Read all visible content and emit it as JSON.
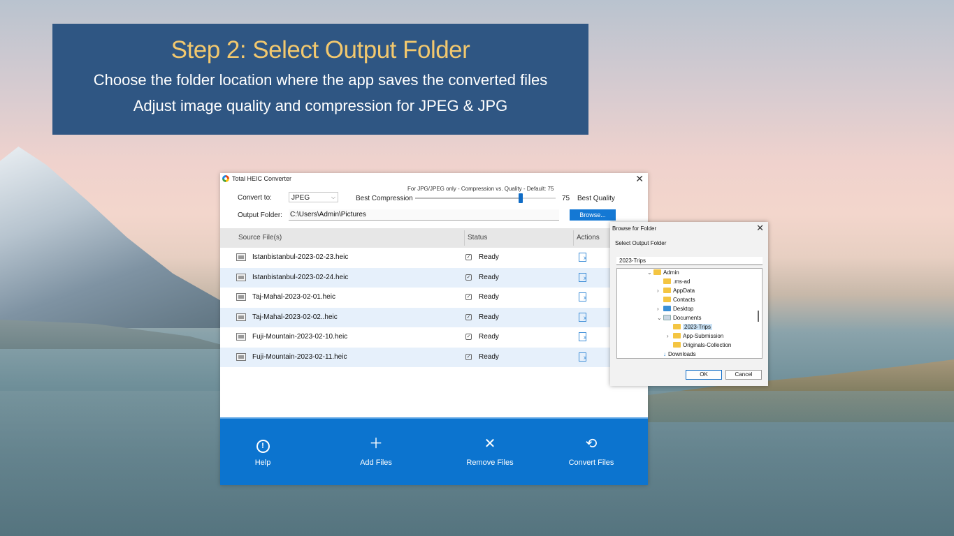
{
  "banner": {
    "title": "Step 2: Select Output Folder",
    "line1": "Choose the folder location where the app saves the converted files",
    "line2": "Adjust image quality and compression for JPEG & JPG"
  },
  "app": {
    "title": "Total HEIC Converter",
    "hint": "For JPG/JPEG only - Compression vs. Quality -  Default: 75",
    "convert_label": "Convert to:",
    "convert_value": "JPEG",
    "best_compression": "Best Compression",
    "quality_value": "75",
    "quality_fraction": 0.75,
    "best_quality": "Best Quality",
    "output_label": "Output Folder:",
    "output_value": "C:\\Users\\Admin\\Pictures",
    "browse_label": "Browse...",
    "columns": {
      "source": "Source File(s)",
      "status": "Status",
      "actions": "Actions"
    },
    "files": [
      {
        "name": "Istanbistanbul-2023-02-23.heic",
        "status": "Ready"
      },
      {
        "name": "Istanbistanbul-2023-02-24.heic",
        "status": "Ready"
      },
      {
        "name": "Taj-Mahal-2023-02-01.heic",
        "status": "Ready"
      },
      {
        "name": "Taj-Mahal-2023-02-02..heic",
        "status": "Ready"
      },
      {
        "name": "Fuji-Mountain-2023-02-10.heic",
        "status": "Ready"
      },
      {
        "name": "Fuji-Mountain-2023-02-11.heic",
        "status": "Ready"
      }
    ],
    "toolbar": {
      "help": "Help",
      "add": "Add Files",
      "remove": "Remove Files",
      "convert": "Convert Files"
    },
    "accent_color": "#0c74cf"
  },
  "dialog": {
    "title": "Browse for Folder",
    "subtitle": "Select Output Folder",
    "input_value": "2023-Trips",
    "tree": [
      {
        "label": "Admin",
        "arrow": "⌄",
        "icon": "folder-icon"
      },
      {
        "label": ".ms-ad",
        "arrow": "",
        "icon": "folder-icon"
      },
      {
        "label": "AppData",
        "arrow": "›",
        "icon": "folder-icon"
      },
      {
        "label": "Contacts",
        "arrow": "",
        "icon": "folder-icon"
      },
      {
        "label": "Desktop",
        "arrow": "›",
        "icon": "desktop-icon"
      },
      {
        "label": "Documents",
        "arrow": "⌄",
        "icon": "documents-icon"
      },
      {
        "label": "2023-Trips",
        "arrow": "",
        "icon": "folder-icon"
      },
      {
        "label": "App-Submission",
        "arrow": "›",
        "icon": "folder-icon"
      },
      {
        "label": "Originals-Collection",
        "arrow": "",
        "icon": "folder-icon"
      },
      {
        "label": "Downloads",
        "arrow": "",
        "icon": "downloads-icon"
      }
    ],
    "ok": "OK",
    "cancel": "Cancel"
  }
}
